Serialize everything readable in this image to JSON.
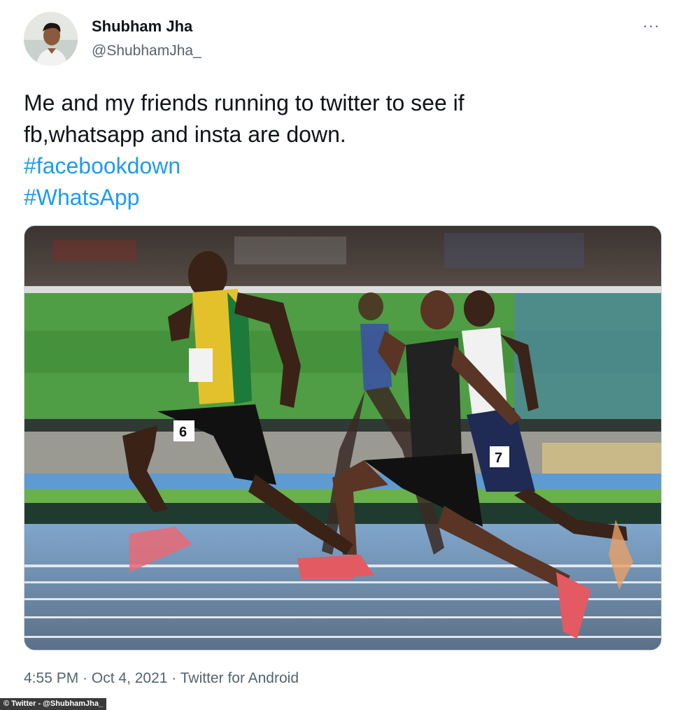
{
  "tweet": {
    "author_name": "Shubham Jha",
    "author_handle": "@ShubhamJha_",
    "text_line1": "Me and my friends running to twitter to see if",
    "text_line2": "fb,whatsapp and insta are down.",
    "hashtags": [
      "#facebookdown",
      "#WhatsApp"
    ],
    "time": "4:55 PM",
    "separator": " · ",
    "date": "Oct 4, 2021",
    "client": "Twitter for Android",
    "more_label": "···"
  },
  "media": {
    "bib_numbers": [
      "6",
      "7"
    ],
    "description_icon": "photo"
  },
  "credit": "© Twitter - @ShubhamJha_",
  "colors": {
    "hashtag": "#1d9bf0",
    "secondary_text": "#536471",
    "primary_text": "#0f1419"
  }
}
